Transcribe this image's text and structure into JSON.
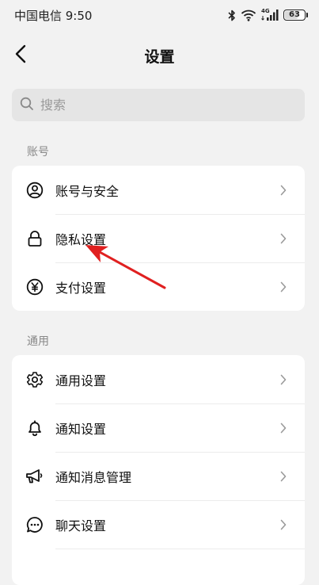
{
  "status_bar": {
    "carrier_time": "中国电信 9:50",
    "network_type": "4G",
    "battery_level": "63",
    "icons": [
      "bluetooth-icon",
      "wifi-icon",
      "cellular-signal-icon",
      "battery-icon"
    ]
  },
  "header": {
    "title": "设置",
    "back_icon": "chevron-left-icon"
  },
  "search": {
    "placeholder": "搜索",
    "value": "",
    "icon": "search-icon"
  },
  "sections": [
    {
      "label": "账号",
      "items": [
        {
          "label": "账号与安全",
          "icon": "user-circle-icon"
        },
        {
          "label": "隐私设置",
          "icon": "lock-icon"
        },
        {
          "label": "支付设置",
          "icon": "yen-circle-icon"
        }
      ]
    },
    {
      "label": "通用",
      "items": [
        {
          "label": "通用设置",
          "icon": "gear-icon"
        },
        {
          "label": "通知设置",
          "icon": "bell-icon"
        },
        {
          "label": "通知消息管理",
          "icon": "megaphone-icon"
        },
        {
          "label": "聊天设置",
          "icon": "chat-bubble-icon"
        }
      ]
    }
  ],
  "annotation": {
    "type": "arrow",
    "color": "#e02020",
    "points_to": "隐私设置"
  },
  "colors": {
    "background": "#f2f2f2",
    "card": "#ffffff",
    "search_bg": "#e5e5e5",
    "section_label": "#888888"
  }
}
